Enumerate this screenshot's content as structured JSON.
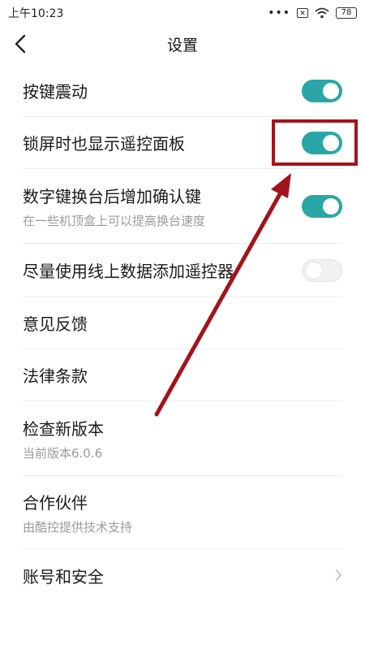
{
  "status_bar": {
    "time": "上午10:23",
    "battery": "78"
  },
  "header": {
    "title": "设置"
  },
  "settings": [
    {
      "label": "按键震动",
      "subtitle": "",
      "control": "toggle",
      "on": true
    },
    {
      "label": "锁屏时也显示遥控面板",
      "subtitle": "",
      "control": "toggle",
      "on": true
    },
    {
      "label": "数字键换台后增加确认键",
      "subtitle": "在一些机顶盒上可以提高换台速度",
      "control": "toggle",
      "on": true
    },
    {
      "label": "尽量使用线上数据添加遥控器",
      "subtitle": "",
      "control": "toggle",
      "on": false
    },
    {
      "label": "意见反馈",
      "subtitle": "",
      "control": "none"
    },
    {
      "label": "法律条款",
      "subtitle": "",
      "control": "none"
    },
    {
      "label": "检查新版本",
      "subtitle": "当前版本6.0.6",
      "control": "none"
    },
    {
      "label": "合作伙伴",
      "subtitle": "由酷控提供技术支持",
      "control": "none"
    },
    {
      "label": "账号和安全",
      "subtitle": "",
      "control": "chevron"
    }
  ],
  "colors": {
    "toggle_on": "#2aa6a6",
    "toggle_off": "#f1f1f1",
    "annotation": "#a4131b"
  }
}
